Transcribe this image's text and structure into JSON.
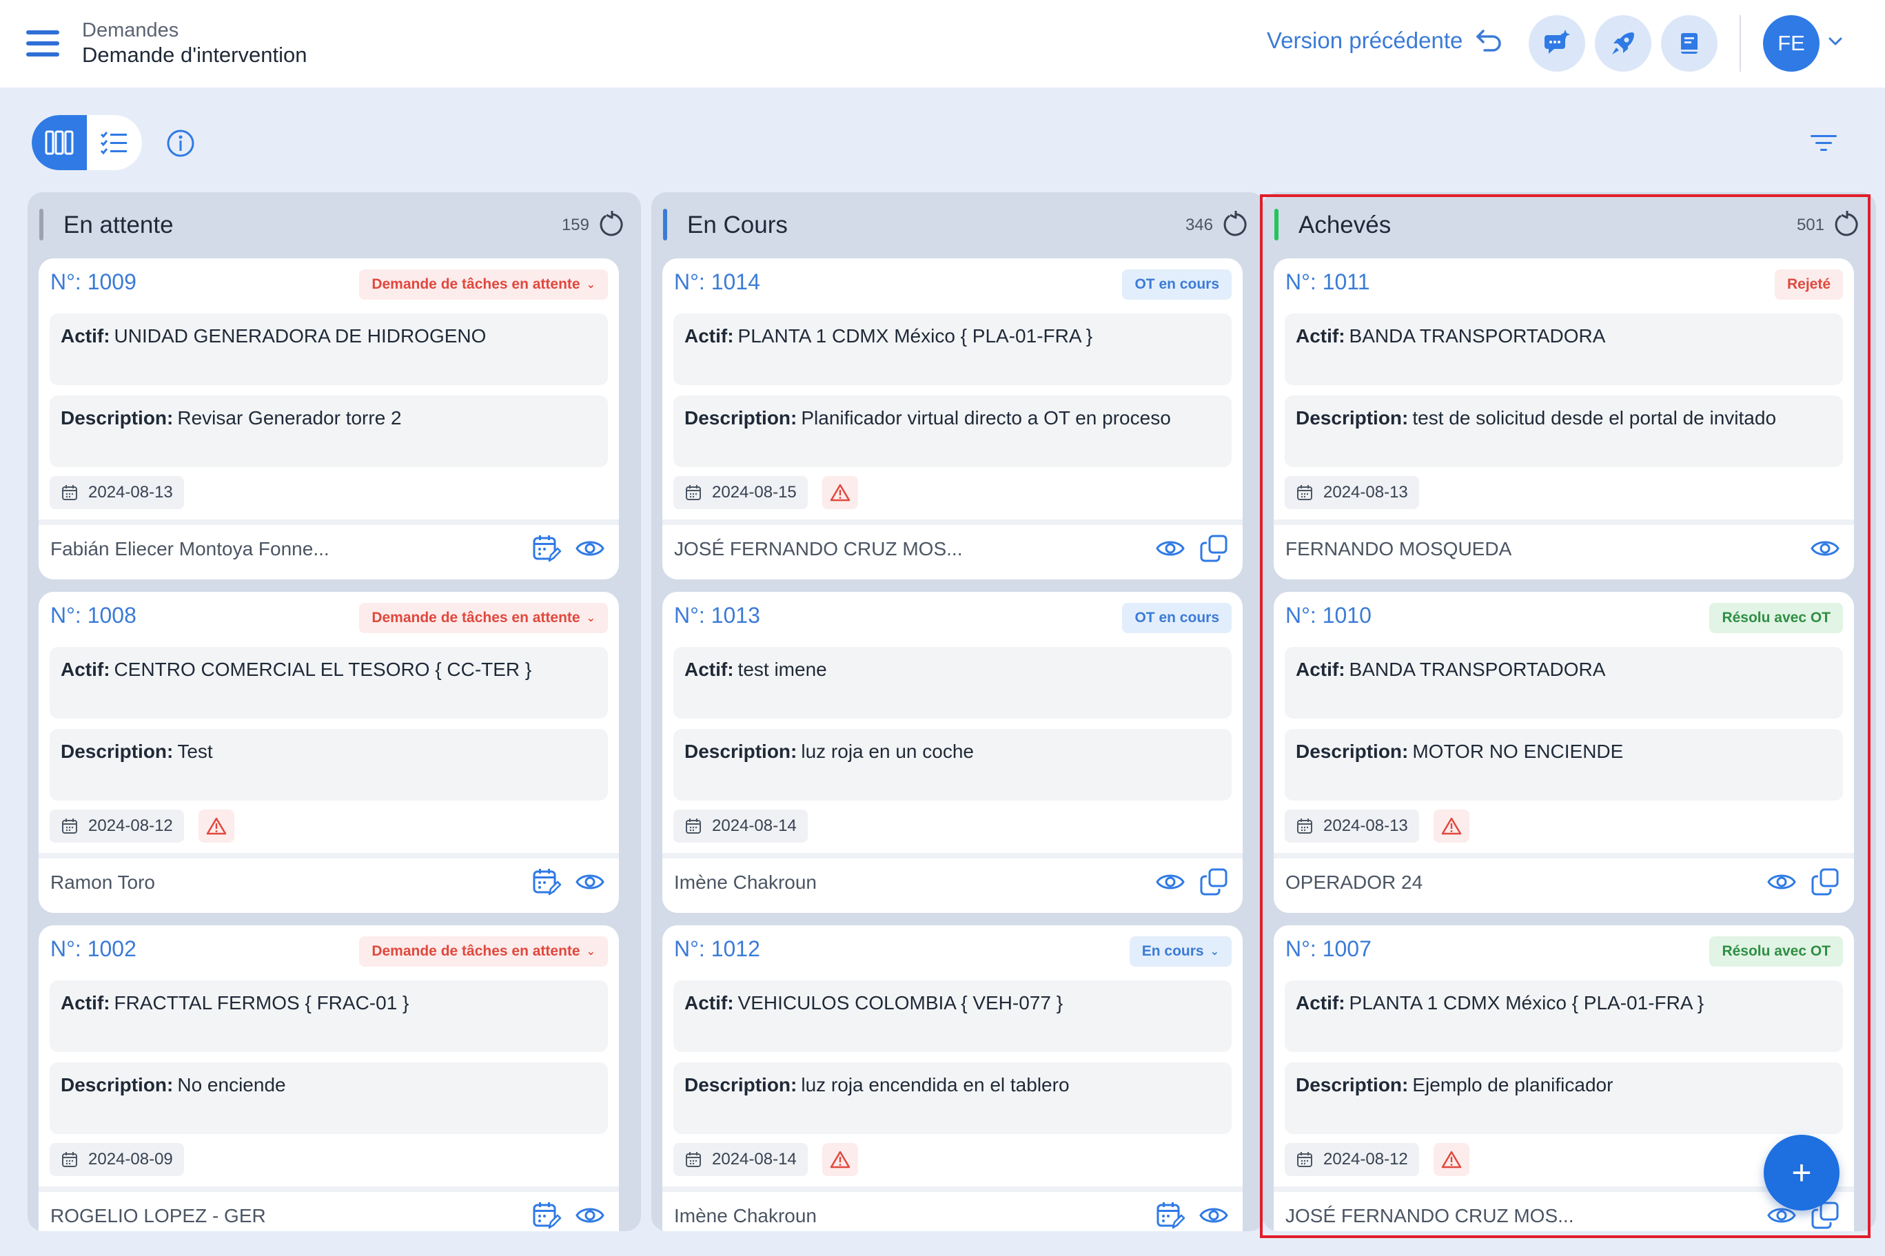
{
  "header": {
    "breadcrumb_parent": "Demandes",
    "breadcrumb_current": "Demande d'intervention",
    "previous_version_label": "Version précédente",
    "avatar_initials": "FE",
    "icons": [
      "menu-icon",
      "chat-sparkle-icon",
      "rocket-icon",
      "book-icon",
      "chevron-down-icon"
    ]
  },
  "toolbar": {
    "views": [
      "kanban-view-icon",
      "list-view-icon"
    ],
    "active_view": "kanban",
    "icons": [
      "info-icon",
      "filter-icon"
    ]
  },
  "colors": {
    "accent": "#2f7ae5",
    "column_pending": "#9ca3af",
    "column_in_progress": "#3b7bd6",
    "column_done": "#22c55e",
    "highlight": "#e11d2a"
  },
  "labels": {
    "asset": "Actif:",
    "description": "Description:"
  },
  "columns": [
    {
      "title": "En attente",
      "count": "159",
      "cards": [
        {
          "number": "N°: 1009",
          "status": "Demande de tâches en attente",
          "status_dropdown": true,
          "asset": "UNIDAD GENERADORA DE HIDROGENO",
          "description": "Revisar Generador torre 2",
          "date": "2024-08-13",
          "warning": false,
          "person": "Fabián Eliecer Montoya Fonne...",
          "actions": [
            "calendar-edit-icon",
            "eye-icon"
          ]
        },
        {
          "number": "N°: 1008",
          "status": "Demande de tâches en attente",
          "status_dropdown": true,
          "asset": "CENTRO COMERCIAL EL TESORO   { CC-TER }",
          "description": "Test",
          "date": "2024-08-12",
          "warning": true,
          "person": "Ramon Toro",
          "actions": [
            "calendar-edit-icon",
            "eye-icon"
          ]
        },
        {
          "number": "N°: 1002",
          "status": "Demande de tâches en attente",
          "status_dropdown": true,
          "asset": "FRACTTAL FERMOS   { FRAC-01 }",
          "description": "No enciende",
          "date": "2024-08-09",
          "warning": false,
          "person": "ROGELIO LOPEZ - GER",
          "actions": [
            "calendar-edit-icon",
            "eye-icon"
          ]
        }
      ]
    },
    {
      "title": "En Cours",
      "count": "346",
      "cards": [
        {
          "number": "N°: 1014",
          "status": "OT en cours",
          "status_dropdown": false,
          "asset": "PLANTA 1 CDMX México { PLA-01-FRA }",
          "description": "Planificador virtual directo a OT en proceso",
          "date": "2024-08-15",
          "warning": true,
          "person": "JOSÉ FERNANDO CRUZ MOS...",
          "actions": [
            "eye-icon",
            "copy-icon"
          ]
        },
        {
          "number": "N°: 1013",
          "status": "OT en cours",
          "status_dropdown": false,
          "asset": "test imene",
          "description": "luz roja en un coche",
          "date": "2024-08-14",
          "warning": false,
          "person": "Imène Chakroun",
          "actions": [
            "eye-icon",
            "copy-icon"
          ]
        },
        {
          "number": "N°: 1012",
          "status": "En cours",
          "status_dropdown": true,
          "asset": "VEHICULOS  COLOMBIA { VEH-077 }",
          "description": "luz roja encendida en el tablero",
          "date": "2024-08-14",
          "warning": true,
          "person": "Imène Chakroun",
          "actions": [
            "calendar-edit-icon",
            "eye-icon"
          ]
        }
      ]
    },
    {
      "title": "Achevés",
      "count": "501",
      "cards": [
        {
          "number": "N°: 1011",
          "status": "Rejeté",
          "status_dropdown": false,
          "asset": "BANDA TRANSPORTADORA",
          "description": "test de solicitud desde el portal de invitado",
          "date": "2024-08-13",
          "warning": false,
          "person": "FERNANDO MOSQUEDA",
          "actions": [
            "eye-icon"
          ]
        },
        {
          "number": "N°: 1010",
          "status": "Résolu avec OT",
          "status_dropdown": false,
          "asset": "BANDA TRANSPORTADORA",
          "description": "MOTOR NO ENCIENDE",
          "date": "2024-08-13",
          "warning": true,
          "person": "OPERADOR 24",
          "actions": [
            "eye-icon",
            "copy-icon"
          ]
        },
        {
          "number": "N°: 1007",
          "status": "Résolu avec OT",
          "status_dropdown": false,
          "asset": "PLANTA 1 CDMX México { PLA-01-FRA }",
          "description": "Ejemplo de planificador",
          "date": "2024-08-12",
          "warning": true,
          "person": "JOSÉ FERNANDO CRUZ MOS...",
          "actions": [
            "eye-icon",
            "copy-icon"
          ]
        }
      ]
    }
  ],
  "fab_label": "+"
}
